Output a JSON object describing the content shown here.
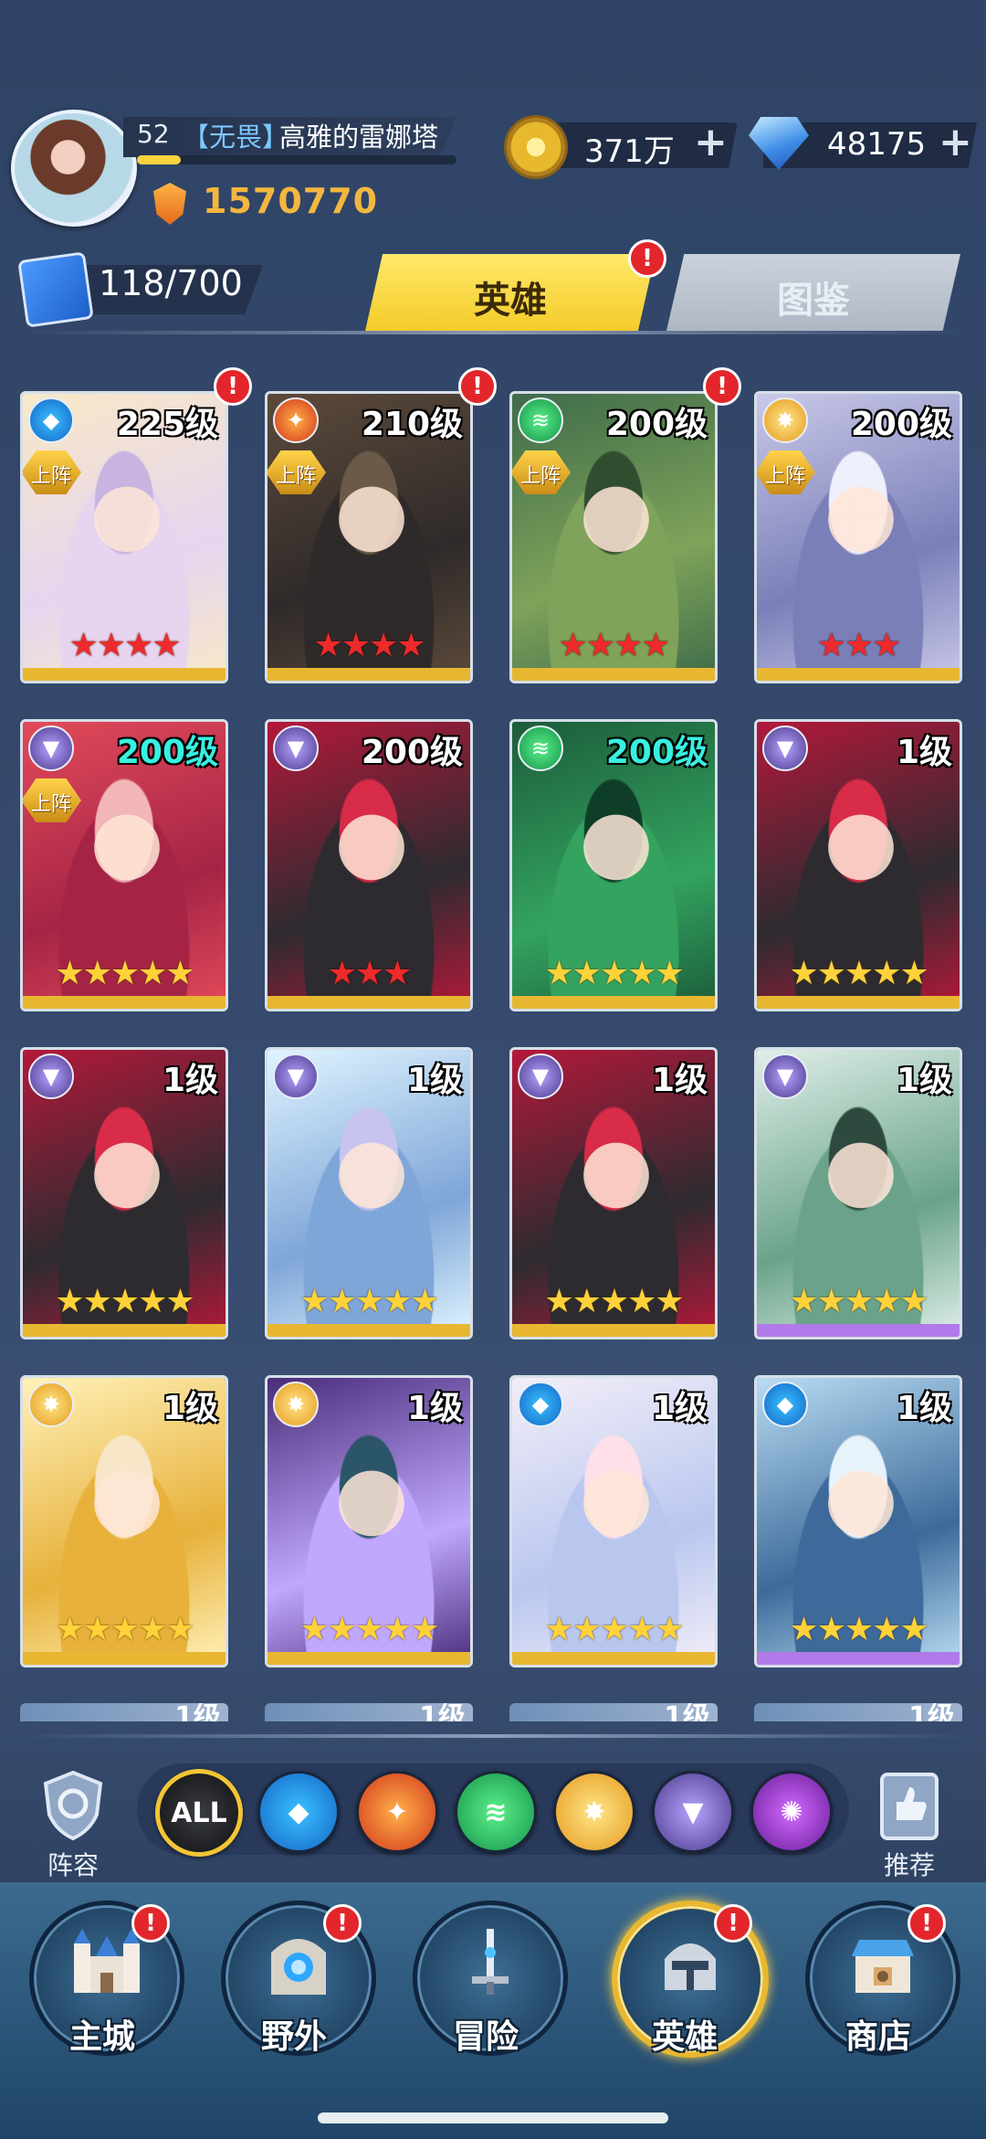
{
  "player": {
    "level": "52",
    "guild": "【无畏】",
    "name": "高雅的雷娜塔",
    "power": "1570770"
  },
  "currency": {
    "coins": "371万",
    "gems": "48175",
    "add_symbol": "+"
  },
  "heroes_count": "118/700",
  "tabs": [
    {
      "label": "英雄",
      "active": true,
      "badge": "!"
    },
    {
      "label": "图鉴",
      "active": false
    }
  ],
  "badge_symbol": "!",
  "on_team_label": "上阵",
  "cards": [
    {
      "level": "225级",
      "element": "water",
      "on_team": true,
      "stars": "★★★★",
      "star_color": "red",
      "badge": true
    },
    {
      "level": "210级",
      "element": "fire",
      "on_team": true,
      "stars": "★★★★",
      "star_color": "red",
      "badge": true
    },
    {
      "level": "200级",
      "element": "wind",
      "on_team": true,
      "stars": "★★★★",
      "star_color": "red",
      "badge": true
    },
    {
      "level": "200级",
      "element": "light",
      "on_team": true,
      "stars": "★★★",
      "star_color": "red",
      "badge": false
    },
    {
      "level": "200级",
      "element": "dark",
      "on_team": true,
      "stars": "★★★★★",
      "star_color": "gold",
      "badge": false
    },
    {
      "level": "200级",
      "element": "dark",
      "on_team": false,
      "stars": "★★★",
      "star_color": "red",
      "badge": false
    },
    {
      "level": "200级",
      "element": "wind",
      "on_team": false,
      "stars": "★★★★★",
      "star_color": "gold",
      "badge": false
    },
    {
      "level": "1级",
      "element": "dark",
      "on_team": false,
      "stars": "★★★★★",
      "star_color": "gold",
      "badge": false
    },
    {
      "level": "1级",
      "element": "dark",
      "on_team": false,
      "stars": "★★★★★",
      "star_color": "gold",
      "badge": false
    },
    {
      "level": "1级",
      "element": "dark",
      "on_team": false,
      "stars": "★★★★★",
      "star_color": "gold",
      "badge": false
    },
    {
      "level": "1级",
      "element": "dark",
      "on_team": false,
      "stars": "★★★★★",
      "star_color": "gold",
      "badge": false
    },
    {
      "level": "1级",
      "element": "dark",
      "on_team": false,
      "stars": "★★★★★",
      "star_color": "gold",
      "badge": false
    },
    {
      "level": "1级",
      "element": "light",
      "on_team": false,
      "stars": "★★★★★",
      "star_color": "gold",
      "badge": false
    },
    {
      "level": "1级",
      "element": "light",
      "on_team": false,
      "stars": "★★★★★",
      "star_color": "gold",
      "badge": false
    },
    {
      "level": "1级",
      "element": "water",
      "on_team": false,
      "stars": "★★★★★",
      "star_color": "gold",
      "badge": false
    },
    {
      "level": "1级",
      "element": "water",
      "on_team": false,
      "stars": "★★★★★",
      "star_color": "gold",
      "badge": false
    }
  ],
  "partial_row_levels": [
    "1级",
    "1级",
    "1级",
    "1级"
  ],
  "filters": {
    "left_label": "阵容",
    "right_label": "推荐",
    "all_label": "ALL",
    "elements": [
      "water",
      "fire",
      "wind",
      "light",
      "dark",
      "arcane"
    ]
  },
  "nav": [
    {
      "label": "主城",
      "icon": "castle-icon",
      "badge": true,
      "active": false
    },
    {
      "label": "野外",
      "icon": "portal-icon",
      "badge": true,
      "active": false
    },
    {
      "label": "冒险",
      "icon": "sword-icon",
      "badge": false,
      "active": false
    },
    {
      "label": "英雄",
      "icon": "helmet-icon",
      "badge": true,
      "active": true
    },
    {
      "label": "商店",
      "icon": "shop-icon",
      "badge": true,
      "active": false
    }
  ]
}
